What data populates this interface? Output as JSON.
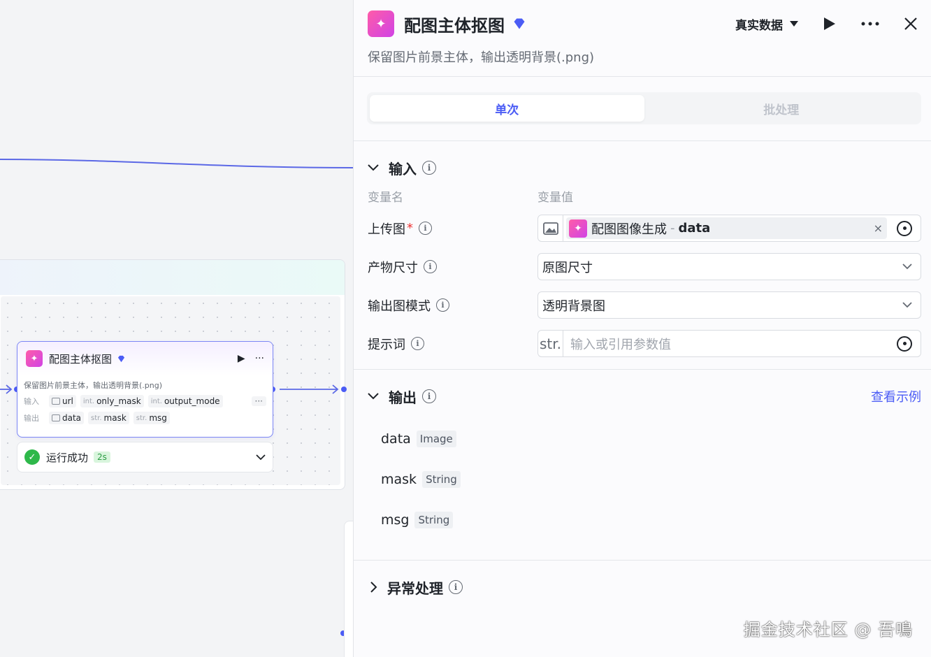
{
  "canvas": {
    "node": {
      "title": "配图主体抠图",
      "description": "保留图片前景主体，输出透明背景(.png)",
      "input_label": "输入",
      "output_label": "输出",
      "inputs": [
        {
          "type": "",
          "name": "url",
          "icon": "image-icon"
        },
        {
          "type": "int.",
          "name": "only_mask"
        },
        {
          "type": "int.",
          "name": "output_mode"
        }
      ],
      "outputs": [
        {
          "type": "",
          "name": "data",
          "icon": "image-icon"
        },
        {
          "type": "str.",
          "name": "mask"
        },
        {
          "type": "str.",
          "name": "msg"
        }
      ],
      "more": "···"
    },
    "status": {
      "text": "运行成功",
      "duration": "2s"
    }
  },
  "panel": {
    "title": "配图主体抠图",
    "description": "保留图片前景主体，输出透明背景(.png)",
    "data_mode": "真实数据",
    "tabs": [
      {
        "label": "单次",
        "active": true
      },
      {
        "label": "批处理",
        "active": false
      }
    ],
    "input_section": {
      "title": "输入",
      "col_name": "变量名",
      "col_value": "变量值",
      "fields": [
        {
          "label": "上传图",
          "required": "*",
          "ref_source": "配图图像生成",
          "ref_sep": "-",
          "ref_var": "data"
        },
        {
          "label": "产物尺寸",
          "value": "原图尺寸"
        },
        {
          "label": "输出图模式",
          "value": "透明背景图"
        },
        {
          "label": "提示词",
          "prefix": "str.",
          "placeholder": "输入或引用参数值"
        }
      ]
    },
    "output_section": {
      "title": "输出",
      "link": "查看示例",
      "items": [
        {
          "name": "data",
          "type": "Image"
        },
        {
          "name": "mask",
          "type": "String"
        },
        {
          "name": "msg",
          "type": "String"
        }
      ]
    },
    "exception_section": {
      "title": "异常处理"
    }
  },
  "watermark": "掘金技术社区 @ 吾鳴",
  "colors": {
    "accent": "#4b5cf5",
    "success": "#2eb84a",
    "icon_gradient_start": "#ff5ca8",
    "icon_gradient_end": "#d043e6"
  }
}
